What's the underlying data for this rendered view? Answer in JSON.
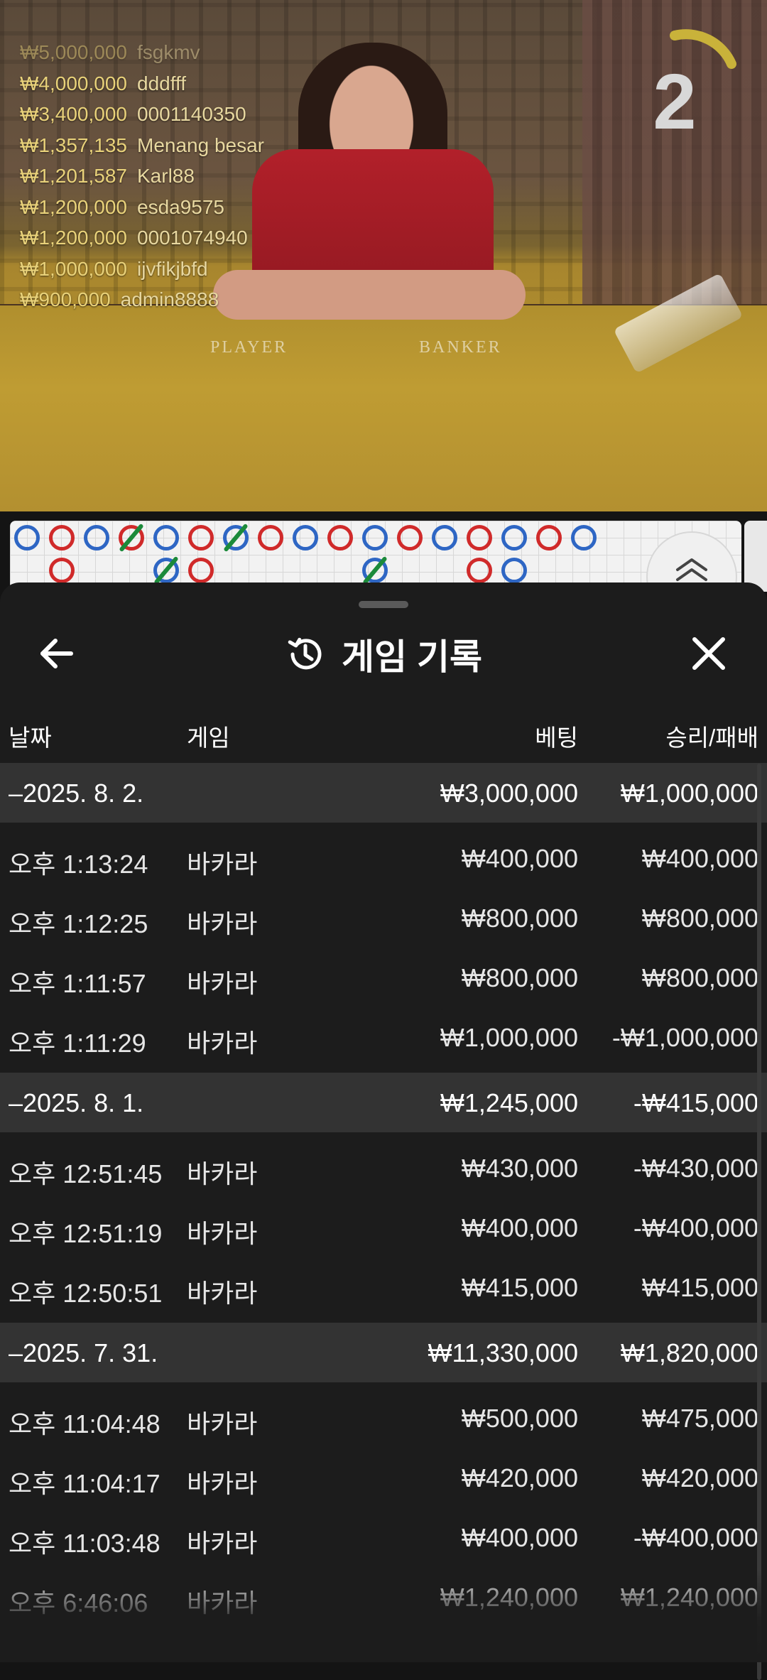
{
  "leaderboard": [
    {
      "amount": "₩5,000,000",
      "name": "fsgkmv",
      "fade": true
    },
    {
      "amount": "₩4,000,000",
      "name": "dddfff"
    },
    {
      "amount": "₩3,400,000",
      "name": "0001140350"
    },
    {
      "amount": "₩1,357,135",
      "name": "Menang besar"
    },
    {
      "amount": "₩1,201,587",
      "name": "Karl88"
    },
    {
      "amount": "₩1,200,000",
      "name": "esda9575"
    },
    {
      "amount": "₩1,200,000",
      "name": "0001074940"
    },
    {
      "amount": "₩1,000,000",
      "name": "ijvfikjbfd"
    },
    {
      "amount": "₩900,000",
      "name": "admin8888"
    }
  ],
  "countdown": "2",
  "table_labels": {
    "player": "PLAYER",
    "banker": "BANKER"
  },
  "roadmap": {
    "beads": [
      {
        "col": 0,
        "row": 0,
        "type": "b"
      },
      {
        "col": 1,
        "row": 0,
        "type": "p"
      },
      {
        "col": 1,
        "row": 1,
        "type": "p"
      },
      {
        "col": 2,
        "row": 0,
        "type": "b"
      },
      {
        "col": 3,
        "row": 0,
        "type": "p",
        "slash": true
      },
      {
        "col": 4,
        "row": 0,
        "type": "b"
      },
      {
        "col": 4,
        "row": 1,
        "type": "b",
        "slash": true
      },
      {
        "col": 5,
        "row": 0,
        "type": "p"
      },
      {
        "col": 5,
        "row": 1,
        "type": "p"
      },
      {
        "col": 6,
        "row": 0,
        "type": "b",
        "slash": true
      },
      {
        "col": 7,
        "row": 0,
        "type": "p"
      },
      {
        "col": 8,
        "row": 0,
        "type": "b"
      },
      {
        "col": 9,
        "row": 0,
        "type": "p"
      },
      {
        "col": 10,
        "row": 0,
        "type": "b"
      },
      {
        "col": 10,
        "row": 1,
        "type": "b",
        "slash": true
      },
      {
        "col": 11,
        "row": 0,
        "type": "p"
      },
      {
        "col": 12,
        "row": 0,
        "type": "b"
      },
      {
        "col": 13,
        "row": 0,
        "type": "p"
      },
      {
        "col": 13,
        "row": 1,
        "type": "p"
      },
      {
        "col": 14,
        "row": 0,
        "type": "b"
      },
      {
        "col": 14,
        "row": 1,
        "type": "b"
      },
      {
        "col": 15,
        "row": 0,
        "type": "p"
      },
      {
        "col": 16,
        "row": 0,
        "type": "b"
      }
    ]
  },
  "sheet": {
    "title": "게임 기록",
    "icons": {
      "back": "arrow-left-icon",
      "history": "history-clock-icon",
      "close": "close-icon"
    },
    "columns": {
      "date": "날짜",
      "game": "게임",
      "bet": "베팅",
      "result": "승리/패배"
    },
    "groups": [
      {
        "date": "2025. 8. 2.",
        "bet": "₩3,000,000",
        "result": "₩1,000,000",
        "rows": [
          {
            "time": "오후 1:13:24",
            "game": "바카라",
            "bet": "₩400,000",
            "result": "₩400,000"
          },
          {
            "time": "오후 1:12:25",
            "game": "바카라",
            "bet": "₩800,000",
            "result": "₩800,000"
          },
          {
            "time": "오후 1:11:57",
            "game": "바카라",
            "bet": "₩800,000",
            "result": "₩800,000"
          },
          {
            "time": "오후 1:11:29",
            "game": "바카라",
            "bet": "₩1,000,000",
            "result": "-₩1,000,000"
          }
        ]
      },
      {
        "date": "2025. 8. 1.",
        "bet": "₩1,245,000",
        "result": "-₩415,000",
        "rows": [
          {
            "time": "오후 12:51:45",
            "game": "바카라",
            "bet": "₩430,000",
            "result": "-₩430,000"
          },
          {
            "time": "오후 12:51:19",
            "game": "바카라",
            "bet": "₩400,000",
            "result": "-₩400,000"
          },
          {
            "time": "오후 12:50:51",
            "game": "바카라",
            "bet": "₩415,000",
            "result": "₩415,000"
          }
        ]
      },
      {
        "date": "2025. 7. 31.",
        "bet": "₩11,330,000",
        "result": "₩1,820,000",
        "rows": [
          {
            "time": "오후 11:04:48",
            "game": "바카라",
            "bet": "₩500,000",
            "result": "₩475,000"
          },
          {
            "time": "오후 11:04:17",
            "game": "바카라",
            "bet": "₩420,000",
            "result": "₩420,000"
          },
          {
            "time": "오후 11:03:48",
            "game": "바카라",
            "bet": "₩400,000",
            "result": "-₩400,000"
          },
          {
            "time": "오후 6:46:06",
            "game": "바카라",
            "bet": "₩1,240,000",
            "result": "₩1,240,000"
          }
        ]
      }
    ]
  },
  "colors": {
    "sheet_bg": "#1c1c1c",
    "group_bg": "#333333",
    "banker": "#2e66c4",
    "player": "#d02a2a",
    "tie": "#1b8a3a"
  }
}
